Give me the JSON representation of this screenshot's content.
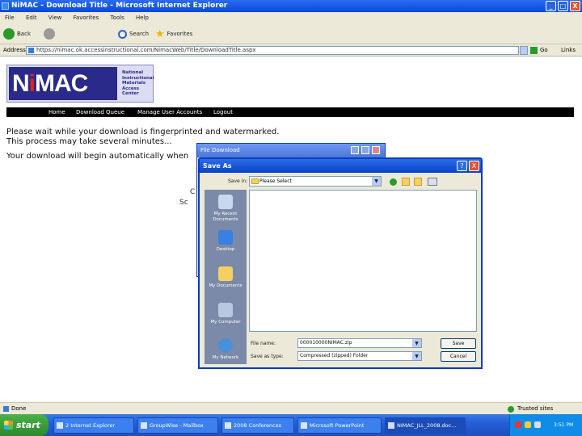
{
  "window": {
    "title": "NiMAC - Download Title - Microsoft Internet Explorer",
    "minimize": "_",
    "maximize": "□",
    "close": "X"
  },
  "menu": [
    "File",
    "Edit",
    "View",
    "Favorites",
    "Tools",
    "Help"
  ],
  "toolbar": {
    "back": "Back",
    "search": "Search",
    "favorites": "Favorites"
  },
  "addressbar": {
    "label": "Address",
    "url": "https://nimac.ok.accessinstructional.com/NimacWeb/Title/DownloadTitle.aspx",
    "go": "Go",
    "links": "Links"
  },
  "logo": {
    "word_a": "N",
    "word_b": "i",
    "word_c": "MAC",
    "tagline": [
      "National",
      "Instructional",
      "Materials",
      "Access",
      "Center"
    ]
  },
  "nav": [
    "Home",
    "Download Queue",
    "Manage User Accounts",
    "Logout"
  ],
  "message": {
    "line1": "Please wait while your download is fingerprinted and watermarked.",
    "line2": "This process may take several minutes...",
    "line3": "Your download will begin automatically when"
  },
  "fragments": {
    "a": "C",
    "b": "Sc"
  },
  "file_download": {
    "title": "File Download"
  },
  "save_as": {
    "title": "Save As",
    "help": "?",
    "close": "X",
    "save_in_label": "Save in:",
    "save_in_value": "Please Select",
    "places": [
      "My Recent Documents",
      "Desktop",
      "My Documents",
      "My Computer",
      "My Network"
    ],
    "file_name_label": "File name:",
    "file_name_value": "000010000NIMAC.zip",
    "save_type_label": "Save as type:",
    "save_type_value": "Compressed (zipped) Folder",
    "save_btn": "Save",
    "cancel_btn": "Cancel"
  },
  "status": {
    "text": "Done",
    "zone": "Trusted sites"
  },
  "taskbar": {
    "start": "start",
    "tasks": [
      "2 Internet Explorer",
      "GroupWise - Mailbox",
      "2008 Conferences",
      "Microsoft PowerPoint",
      "NIMAC_JLL_2008.doc..."
    ],
    "time": "3:51 PM"
  }
}
